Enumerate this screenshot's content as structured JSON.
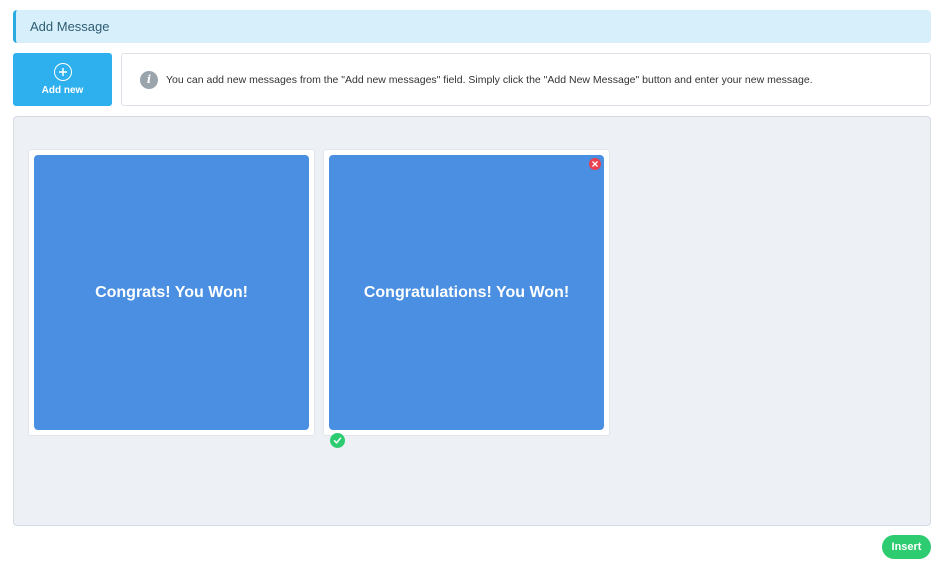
{
  "header": {
    "title": "Add Message"
  },
  "toolbar": {
    "add_new_label": "Add new",
    "add_new_icon": "plus-circle-icon"
  },
  "info": {
    "icon": "info-icon",
    "text": "You can add new messages from the \"Add new messages\" field. Simply click the \"Add New Message\" button and enter your new message."
  },
  "messages": [
    {
      "text": "Congrats! You Won!",
      "selected": false,
      "deletable": false
    },
    {
      "text": "Congratulations! You Won!",
      "selected": true,
      "deletable": true
    }
  ],
  "footer": {
    "insert_label": "Insert"
  },
  "colors": {
    "accent": "#2fb0ee",
    "card": "#4a8fe1",
    "success": "#2ecc71",
    "danger": "#e8404f",
    "header_bg": "#d6effa"
  }
}
